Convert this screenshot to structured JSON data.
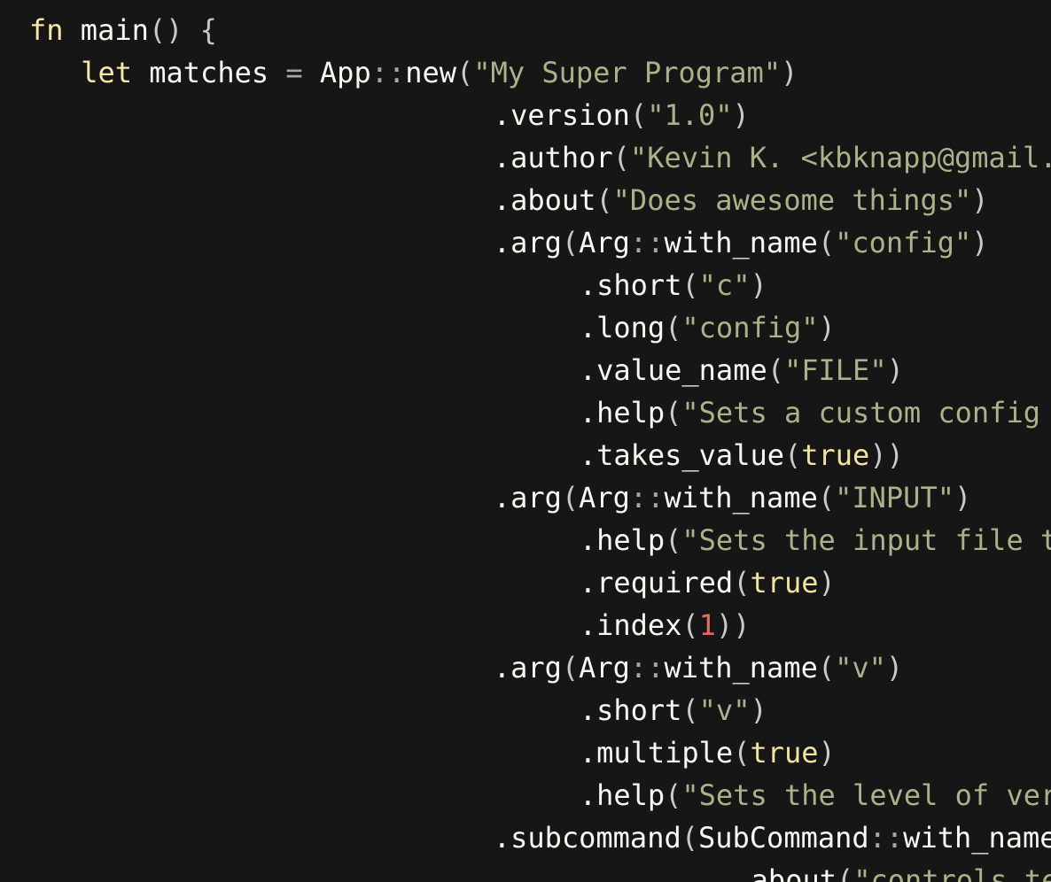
{
  "colors": {
    "background": "#161616",
    "identifier": "#f8f8f2",
    "keyword": "#f4e9a6",
    "string": "#aeb08a",
    "boolean": "#f1e3a0",
    "number": "#e56b5c",
    "punctuation": "#c9c9c9"
  },
  "code": {
    "language": "Rust",
    "lines": [
      {
        "indent": 1,
        "tokens": [
          {
            "t": "fn",
            "k": "kw"
          },
          {
            "t": " main",
            "k": "ident"
          },
          {
            "t": "() {",
            "k": "punc"
          }
        ]
      },
      {
        "indent": 4,
        "tokens": [
          {
            "t": "let",
            "k": "kw"
          },
          {
            "t": " matches ",
            "k": "ident"
          },
          {
            "t": "=",
            "k": "op"
          },
          {
            "t": " App",
            "k": "ident"
          },
          {
            "t": "::",
            "k": "op"
          },
          {
            "t": "new",
            "k": "ident"
          },
          {
            "t": "(",
            "k": "punc"
          },
          {
            "t": "\"My Super Program\"",
            "k": "str"
          },
          {
            "t": ")",
            "k": "punc"
          }
        ]
      },
      {
        "indent": 28,
        "tokens": [
          {
            "t": ".version",
            "k": "ident"
          },
          {
            "t": "(",
            "k": "punc"
          },
          {
            "t": "\"1.0\"",
            "k": "str"
          },
          {
            "t": ")",
            "k": "punc"
          }
        ]
      },
      {
        "indent": 28,
        "tokens": [
          {
            "t": ".author",
            "k": "ident"
          },
          {
            "t": "(",
            "k": "punc"
          },
          {
            "t": "\"Kevin K. <kbknapp@gmail.c",
            "k": "str"
          }
        ]
      },
      {
        "indent": 28,
        "tokens": [
          {
            "t": ".about",
            "k": "ident"
          },
          {
            "t": "(",
            "k": "punc"
          },
          {
            "t": "\"Does awesome things\"",
            "k": "str"
          },
          {
            "t": ")",
            "k": "punc"
          }
        ]
      },
      {
        "indent": 28,
        "tokens": [
          {
            "t": ".arg",
            "k": "ident"
          },
          {
            "t": "(",
            "k": "punc"
          },
          {
            "t": "Arg",
            "k": "ident"
          },
          {
            "t": "::",
            "k": "op"
          },
          {
            "t": "with_name",
            "k": "ident"
          },
          {
            "t": "(",
            "k": "punc"
          },
          {
            "t": "\"config\"",
            "k": "str"
          },
          {
            "t": ")",
            "k": "punc"
          }
        ]
      },
      {
        "indent": 33,
        "tokens": [
          {
            "t": ".short",
            "k": "ident"
          },
          {
            "t": "(",
            "k": "punc"
          },
          {
            "t": "\"c\"",
            "k": "str"
          },
          {
            "t": ")",
            "k": "punc"
          }
        ]
      },
      {
        "indent": 33,
        "tokens": [
          {
            "t": ".long",
            "k": "ident"
          },
          {
            "t": "(",
            "k": "punc"
          },
          {
            "t": "\"config\"",
            "k": "str"
          },
          {
            "t": ")",
            "k": "punc"
          }
        ]
      },
      {
        "indent": 33,
        "tokens": [
          {
            "t": ".value_name",
            "k": "ident"
          },
          {
            "t": "(",
            "k": "punc"
          },
          {
            "t": "\"FILE\"",
            "k": "str"
          },
          {
            "t": ")",
            "k": "punc"
          }
        ]
      },
      {
        "indent": 33,
        "tokens": [
          {
            "t": ".help",
            "k": "ident"
          },
          {
            "t": "(",
            "k": "punc"
          },
          {
            "t": "\"Sets a custom config f",
            "k": "str"
          }
        ]
      },
      {
        "indent": 33,
        "tokens": [
          {
            "t": ".takes_value",
            "k": "ident"
          },
          {
            "t": "(",
            "k": "punc"
          },
          {
            "t": "true",
            "k": "bool"
          },
          {
            "t": "))",
            "k": "punc"
          }
        ]
      },
      {
        "indent": 28,
        "tokens": [
          {
            "t": ".arg",
            "k": "ident"
          },
          {
            "t": "(",
            "k": "punc"
          },
          {
            "t": "Arg",
            "k": "ident"
          },
          {
            "t": "::",
            "k": "op"
          },
          {
            "t": "with_name",
            "k": "ident"
          },
          {
            "t": "(",
            "k": "punc"
          },
          {
            "t": "\"INPUT\"",
            "k": "str"
          },
          {
            "t": ")",
            "k": "punc"
          }
        ]
      },
      {
        "indent": 33,
        "tokens": [
          {
            "t": ".help",
            "k": "ident"
          },
          {
            "t": "(",
            "k": "punc"
          },
          {
            "t": "\"Sets the input file to",
            "k": "str"
          }
        ]
      },
      {
        "indent": 33,
        "tokens": [
          {
            "t": ".required",
            "k": "ident"
          },
          {
            "t": "(",
            "k": "punc"
          },
          {
            "t": "true",
            "k": "bool"
          },
          {
            "t": ")",
            "k": "punc"
          }
        ]
      },
      {
        "indent": 33,
        "tokens": [
          {
            "t": ".index",
            "k": "ident"
          },
          {
            "t": "(",
            "k": "punc"
          },
          {
            "t": "1",
            "k": "num"
          },
          {
            "t": "))",
            "k": "punc"
          }
        ]
      },
      {
        "indent": 28,
        "tokens": [
          {
            "t": ".arg",
            "k": "ident"
          },
          {
            "t": "(",
            "k": "punc"
          },
          {
            "t": "Arg",
            "k": "ident"
          },
          {
            "t": "::",
            "k": "op"
          },
          {
            "t": "with_name",
            "k": "ident"
          },
          {
            "t": "(",
            "k": "punc"
          },
          {
            "t": "\"v\"",
            "k": "str"
          },
          {
            "t": ")",
            "k": "punc"
          }
        ]
      },
      {
        "indent": 33,
        "tokens": [
          {
            "t": ".short",
            "k": "ident"
          },
          {
            "t": "(",
            "k": "punc"
          },
          {
            "t": "\"v\"",
            "k": "str"
          },
          {
            "t": ")",
            "k": "punc"
          }
        ]
      },
      {
        "indent": 33,
        "tokens": [
          {
            "t": ".multiple",
            "k": "ident"
          },
          {
            "t": "(",
            "k": "punc"
          },
          {
            "t": "true",
            "k": "bool"
          },
          {
            "t": ")",
            "k": "punc"
          }
        ]
      },
      {
        "indent": 33,
        "tokens": [
          {
            "t": ".help",
            "k": "ident"
          },
          {
            "t": "(",
            "k": "punc"
          },
          {
            "t": "\"Sets the level of verb",
            "k": "str"
          }
        ]
      },
      {
        "indent": 28,
        "tokens": [
          {
            "t": ".subcommand",
            "k": "ident"
          },
          {
            "t": "(",
            "k": "punc"
          },
          {
            "t": "SubCommand",
            "k": "ident"
          },
          {
            "t": "::",
            "k": "op"
          },
          {
            "t": "with_name",
            "k": "ident"
          },
          {
            "t": "(",
            "k": "punc"
          }
        ]
      },
      {
        "indent": 42,
        "tokens": [
          {
            "t": ".about",
            "k": "ident"
          },
          {
            "t": "(",
            "k": "punc"
          },
          {
            "t": "\"controls testi",
            "k": "str"
          }
        ]
      }
    ]
  }
}
